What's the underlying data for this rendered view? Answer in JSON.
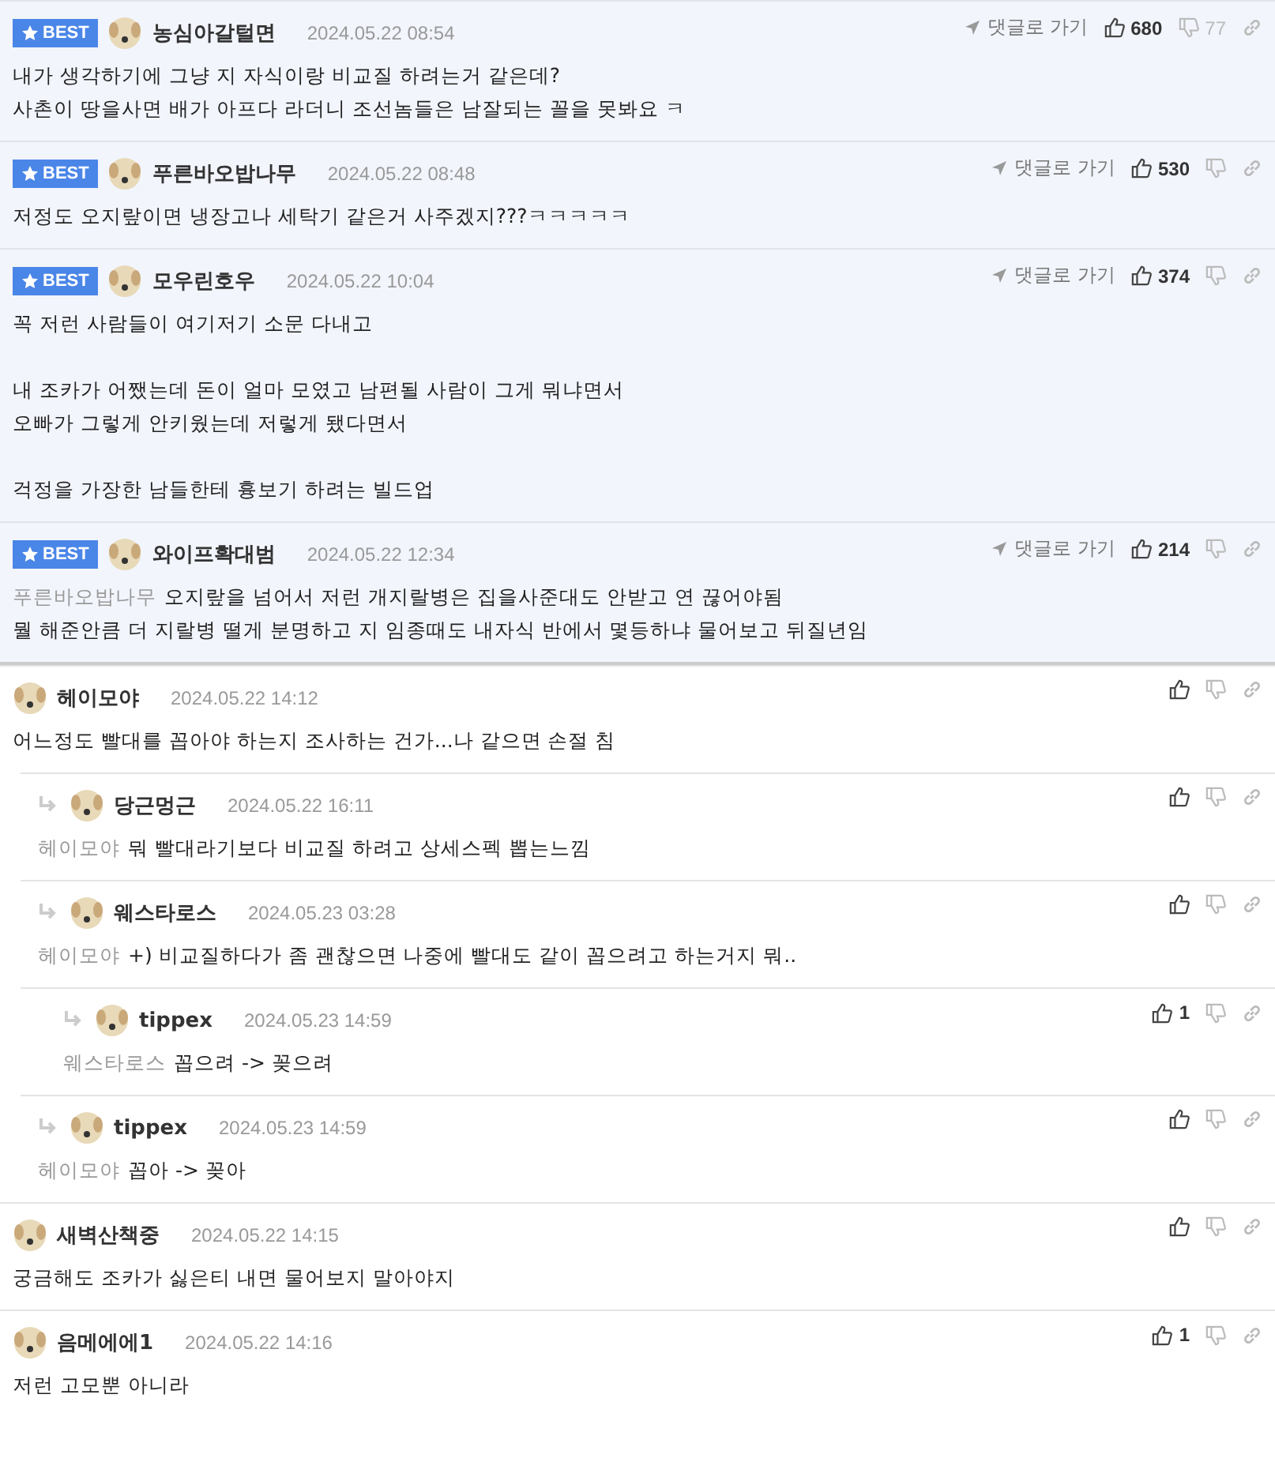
{
  "best_comments": [
    {
      "badge": "BEST",
      "author": "농심아갈털면",
      "date": "2024.05.22 08:54",
      "goto": "댓글로 가기",
      "up": "680",
      "down": "77",
      "text": "내가 생각하기에 그냥 지 자식이랑 비교질 하려는거 같은데?\n사촌이 땅을사면 배가 아프다 라더니 조선놈들은 남잘되는 꼴을 못봐요 ㅋ"
    },
    {
      "badge": "BEST",
      "author": "푸른바오밥나무",
      "date": "2024.05.22 08:48",
      "goto": "댓글로 가기",
      "up": "530",
      "text": "저정도 오지랖이면 냉장고나 세탁기 같은거 사주겠지???ㅋㅋㅋㅋㅋ"
    },
    {
      "badge": "BEST",
      "author": "모우린호우",
      "date": "2024.05.22 10:04",
      "goto": "댓글로 가기",
      "up": "374",
      "text": "꼭 저런 사람들이 여기저기 소문 다내고\n\n내 조카가 어쨌는데 돈이 얼마 모였고 남편될 사람이 그게 뭐냐면서\n오빠가 그렇게 안키웠는데 저렇게 됐다면서\n\n걱정을 가장한 남들한테 흉보기 하려는 빌드업"
    },
    {
      "badge": "BEST",
      "author": "와이프확대범",
      "date": "2024.05.22 12:34",
      "goto": "댓글로 가기",
      "up": "214",
      "mention": "푸른바오밥나무",
      "text": "오지랖을 넘어서 저런 개지랄병은 집을사준대도 안받고 연 끊어야됨\n뭘 해준안큼 더 지랄병 떨게 분명하고 지 임종때도 내자식 반에서 몇등하냐 물어보고 뒤질년임"
    }
  ],
  "comments": [
    {
      "author": "헤이모야",
      "date": "2024.05.22 14:12",
      "text": "어느정도 빨대를 꼽아야 하는지 조사하는 건가...나 같으면 손절 침",
      "children": [
        {
          "author": "당근멍근",
          "date": "2024.05.22 16:11",
          "mention": "헤이모야",
          "text": "뭐 빨대라기보다 비교질 하려고 상세스펙 뽑는느낌"
        },
        {
          "author": "웨스타로스",
          "date": "2024.05.23 03:28",
          "mention": "헤이모야",
          "text": "+) 비교질하다가 좀 괜찮으면 나중에 빨대도 같이 꼽으려고 하는거지 뭐..",
          "children": [
            {
              "author": "tippex",
              "date": "2024.05.23 14:59",
              "up": "1",
              "mention": "웨스타로스",
              "text": "꼽으려 -> 꽂으려"
            }
          ]
        },
        {
          "author": "tippex",
          "date": "2024.05.23 14:59",
          "mention": "헤이모야",
          "text": "꼽아 -> 꽂아"
        }
      ]
    },
    {
      "author": "새벽산책중",
      "date": "2024.05.22 14:15",
      "text": "궁금해도 조카가 싫은티 내면 물어보지 말아야지"
    },
    {
      "author": "음메에에1",
      "date": "2024.05.22 14:16",
      "up": "1",
      "text": "저런 고모뿐 아니라"
    }
  ]
}
